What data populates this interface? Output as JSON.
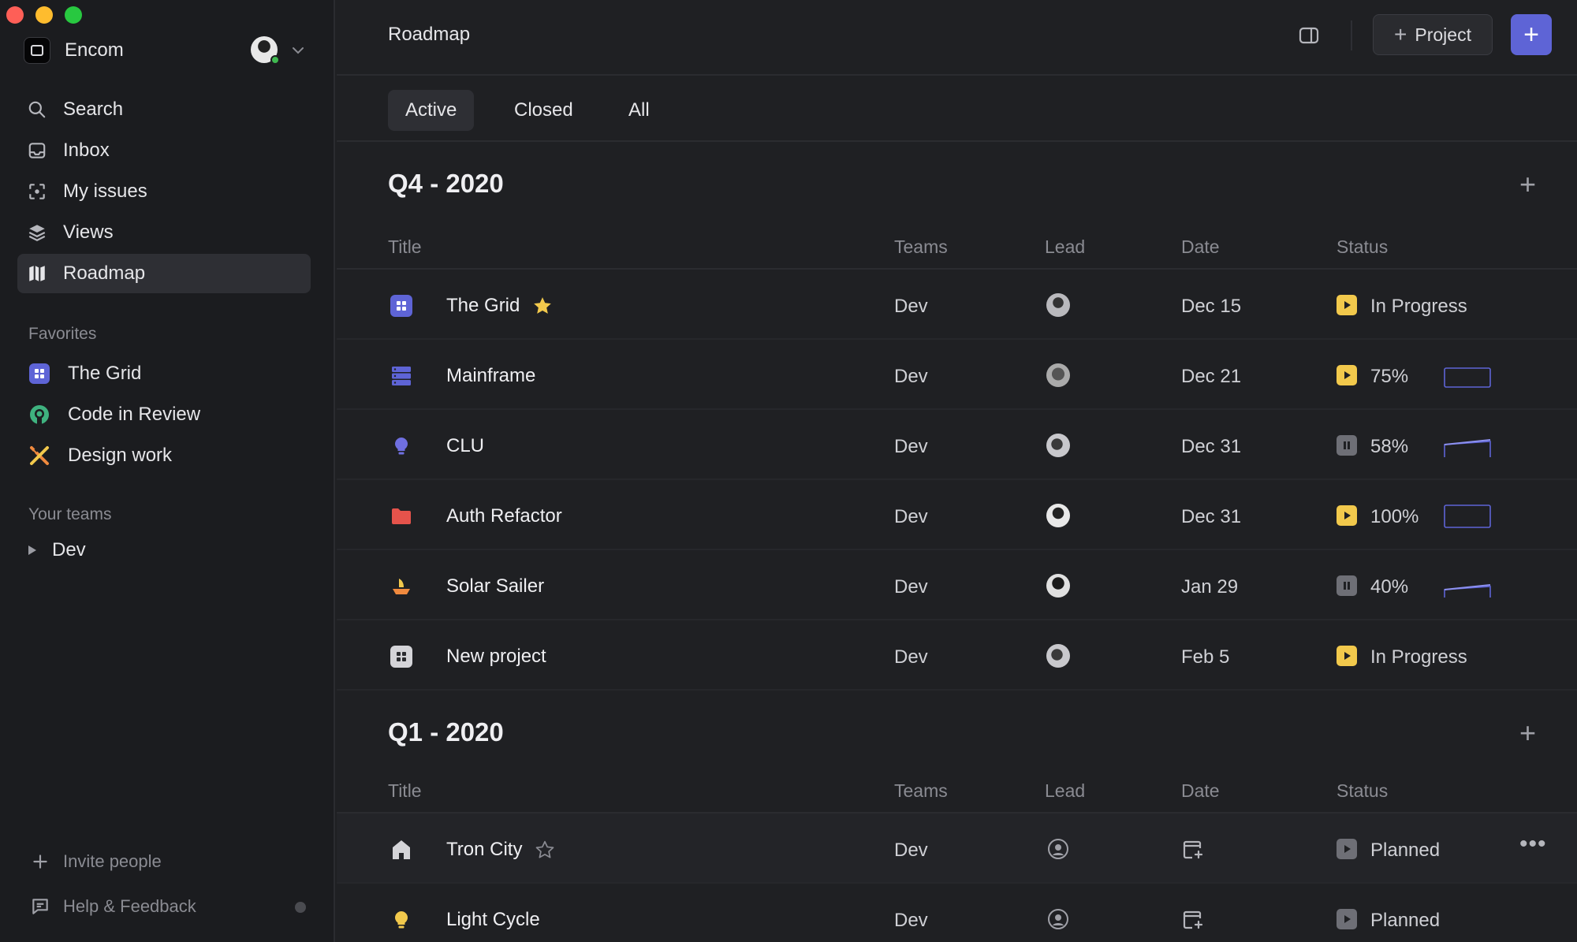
{
  "sidebar": {
    "workspace": {
      "name": "Encom"
    },
    "nav": [
      {
        "label": "Search",
        "icon": "search-icon"
      },
      {
        "label": "Inbox",
        "icon": "inbox-icon"
      },
      {
        "label": "My issues",
        "icon": "my-issues-icon"
      },
      {
        "label": "Views",
        "icon": "layers-icon"
      },
      {
        "label": "Roadmap",
        "icon": "map-icon",
        "active": true
      }
    ],
    "favorites_label": "Favorites",
    "favorites": [
      {
        "label": "The Grid",
        "icon": "grid-project-icon"
      },
      {
        "label": "Code in Review",
        "icon": "github-icon"
      },
      {
        "label": "Design work",
        "icon": "design-tools-icon"
      }
    ],
    "teams_label": "Your teams",
    "teams": [
      {
        "label": "Dev"
      }
    ],
    "invite_label": "Invite people",
    "help_label": "Help & Feedback"
  },
  "header": {
    "title": "Roadmap",
    "project_button": "Project"
  },
  "tabs": [
    {
      "label": "Active",
      "active": true
    },
    {
      "label": "Closed"
    },
    {
      "label": "All"
    }
  ],
  "columns": {
    "title": "Title",
    "teams": "Teams",
    "lead": "Lead",
    "date": "Date",
    "status": "Status"
  },
  "groups": [
    {
      "title": "Q4 - 2020",
      "rows": [
        {
          "title": "The Grid",
          "icon": "grid-project-icon",
          "starred": true,
          "team": "Dev",
          "date": "Dec 15",
          "status": "In Progress",
          "status_icon": "play",
          "progress": null
        },
        {
          "title": "Mainframe",
          "icon": "server-icon",
          "team": "Dev",
          "date": "Dec 21",
          "status": "75%",
          "status_icon": "play",
          "progress": 0.75
        },
        {
          "title": "CLU",
          "icon": "bulb-icon",
          "team": "Dev",
          "date": "Dec 31",
          "status": "58%",
          "status_icon": "pause",
          "progress": 0.58
        },
        {
          "title": "Auth Refactor",
          "icon": "folder-icon",
          "team": "Dev",
          "date": "Dec 31",
          "status": "100%",
          "status_icon": "play",
          "progress": 1.0
        },
        {
          "title": "Solar Sailer",
          "icon": "boat-icon",
          "team": "Dev",
          "date": "Jan 29",
          "status": "40%",
          "status_icon": "pause",
          "progress": 0.4
        },
        {
          "title": "New project",
          "icon": "grid-gray-icon",
          "team": "Dev",
          "date": "Feb 5",
          "status": "In Progress",
          "status_icon": "play",
          "progress": null
        }
      ]
    },
    {
      "title": "Q1 - 2020",
      "rows": [
        {
          "title": "Tron City",
          "icon": "home-icon",
          "starred_outline": true,
          "team": "Dev",
          "date": "",
          "status": "Planned",
          "status_icon": "planned",
          "more": true
        },
        {
          "title": "Light Cycle",
          "icon": "bulb-yellow-icon",
          "team": "Dev",
          "date": "",
          "status": "Planned",
          "status_icon": "planned"
        }
      ]
    }
  ],
  "colors": {
    "accent": "#5e64d6",
    "in_progress": "#f2c94c",
    "paused": "#6e6f76"
  }
}
